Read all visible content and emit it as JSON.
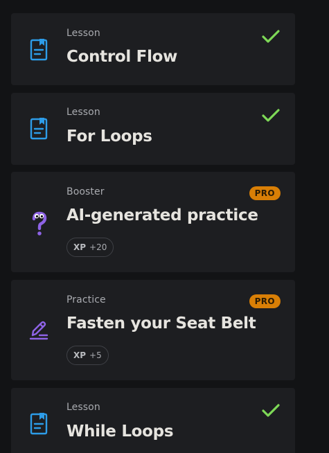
{
  "colors": {
    "card_bg": "#1d1e21",
    "page_bg": "#121315",
    "lesson_icon": "#2d9ce8",
    "practice_icon": "#8e63e6",
    "check": "#7ed957",
    "pro_badge": "#d97f06"
  },
  "items": [
    {
      "type": "Lesson",
      "title": "Control Flow",
      "icon": "lesson-document-icon",
      "status": "completed"
    },
    {
      "type": "Lesson",
      "title": "For Loops",
      "icon": "lesson-document-icon",
      "status": "completed"
    },
    {
      "type": "Booster",
      "title": "AI-generated practice",
      "icon": "question-mark-mascot-icon",
      "badge": "PRO",
      "xp_label": "XP",
      "xp_value": "+20"
    },
    {
      "type": "Practice",
      "title": "Fasten your Seat Belt",
      "icon": "pencil-edit-icon",
      "badge": "PRO",
      "xp_label": "XP",
      "xp_value": "+5"
    },
    {
      "type": "Lesson",
      "title": "While Loops",
      "icon": "lesson-document-icon",
      "status": "completed"
    }
  ]
}
